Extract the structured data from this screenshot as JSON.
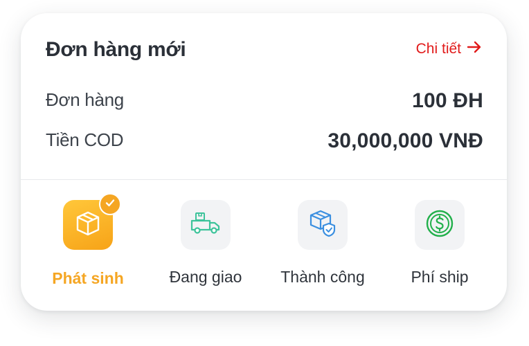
{
  "header": {
    "title": "Đơn hàng mới",
    "detail_label": "Chi tiết",
    "detail_icon": "arrow-right-icon"
  },
  "summary": {
    "orders_label": "Đơn hàng",
    "orders_value": "100 ĐH",
    "cod_label": "Tiền COD",
    "cod_value": "30,000,000 VNĐ"
  },
  "tabs": [
    {
      "label": "Phát sinh",
      "icon": "box-icon",
      "active": true
    },
    {
      "label": "Đang giao",
      "icon": "delivery-truck-icon",
      "active": false
    },
    {
      "label": "Thành công",
      "icon": "box-shield-icon",
      "active": false
    },
    {
      "label": "Phí ship",
      "icon": "dollar-coin-icon",
      "active": false
    }
  ],
  "colors": {
    "accent_red": "#e11a1a",
    "active_orange": "#f5a623",
    "truck_green": "#3cc39a",
    "shield_blue": "#3b8fe0",
    "coin_green": "#22b04b"
  }
}
